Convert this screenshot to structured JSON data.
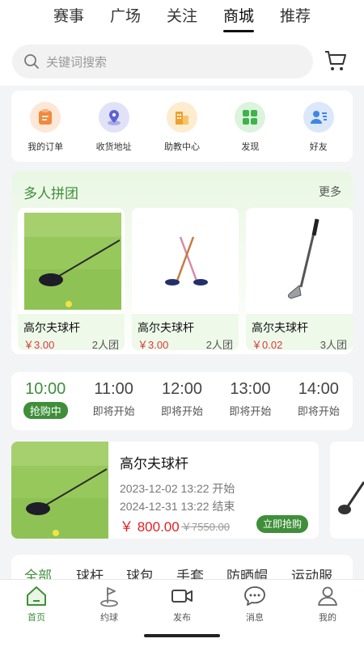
{
  "top_tabs": [
    "赛事",
    "广场",
    "关注",
    "商城",
    "推荐"
  ],
  "active_top_tab": "商城",
  "search": {
    "placeholder": "关键词搜索"
  },
  "quick_links": [
    {
      "label": "我的订单",
      "icon": "order-icon",
      "color": "#f08a3c"
    },
    {
      "label": "收货地址",
      "icon": "location-icon",
      "color": "#5b62d6"
    },
    {
      "label": "助教中心",
      "icon": "building-icon",
      "color": "#f0a030"
    },
    {
      "label": "发现",
      "icon": "grid-icon",
      "color": "#3db34a"
    },
    {
      "label": "好友",
      "icon": "friends-icon",
      "color": "#3f86e0"
    }
  ],
  "group_buy": {
    "title": "多人拼团",
    "more": "更多",
    "items": [
      {
        "name": "高尔夫球杆",
        "price": "￥3.00",
        "team": "2人团"
      },
      {
        "name": "高尔夫球杆",
        "price": "￥3.00",
        "team": "2人团"
      },
      {
        "name": "高尔夫球杆",
        "price": "￥0.02",
        "team": "3人团"
      }
    ]
  },
  "time_slots": [
    {
      "time": "10:00",
      "state": "抢购中"
    },
    {
      "time": "11:00",
      "state": "即将开始"
    },
    {
      "time": "12:00",
      "state": "即将开始"
    },
    {
      "time": "13:00",
      "state": "即将开始"
    },
    {
      "time": "14:00",
      "state": "即将开始"
    }
  ],
  "flash_sale": {
    "name": "高尔夫球杆",
    "start": "2023-12-02 13:22  开始",
    "end": "2024-12-31 13:22  结束",
    "price": "￥ 800.00",
    "original_price": "￥7550.00",
    "button": "立即抢购"
  },
  "categories": [
    "全部",
    "球杆",
    "球包",
    "手套",
    "防晒帽",
    "运动服"
  ],
  "bottom_nav": [
    {
      "label": "首页",
      "icon": "home-icon"
    },
    {
      "label": "约球",
      "icon": "flag-icon"
    },
    {
      "label": "发布",
      "icon": "video-icon"
    },
    {
      "label": "消息",
      "icon": "message-icon"
    },
    {
      "label": "我的",
      "icon": "user-icon"
    }
  ],
  "colors": {
    "accent": "#3f8f3a",
    "price": "#d83a3a"
  }
}
